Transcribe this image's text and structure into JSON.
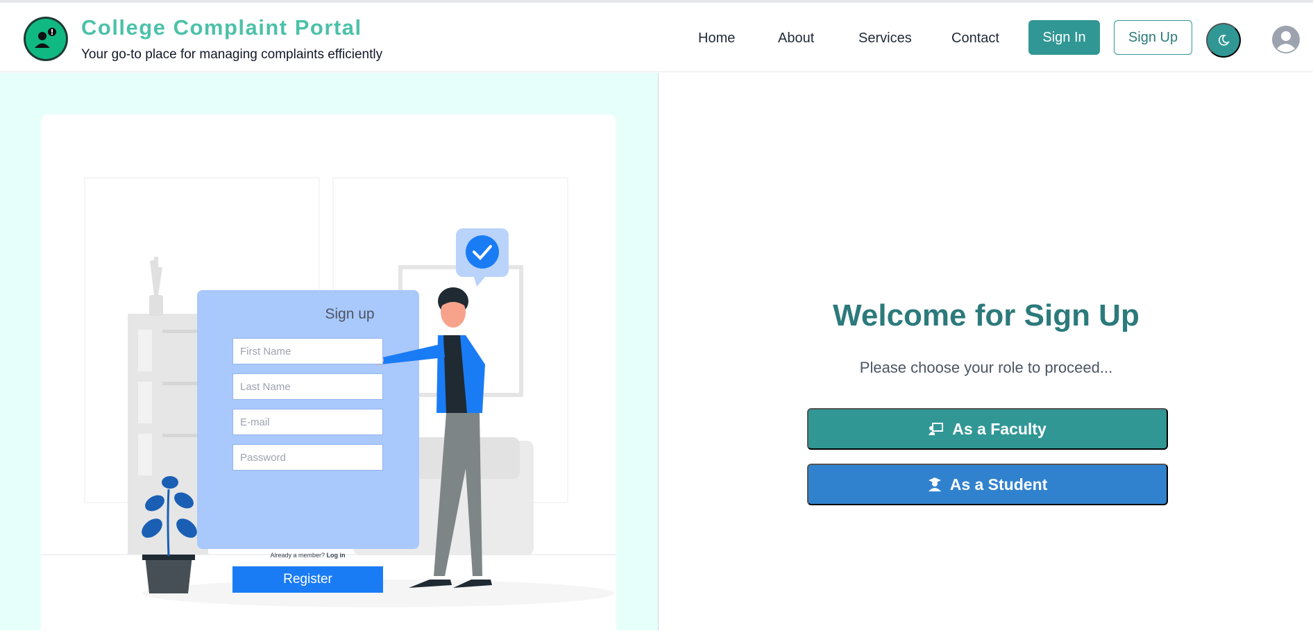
{
  "header": {
    "title": "College Complaint Portal",
    "subtitle": "Your go-to place for managing complaints efficiently",
    "nav": [
      "Home",
      "About",
      "Services",
      "Contact"
    ],
    "signin_label": "Sign In",
    "signup_label": "Sign Up"
  },
  "illustration": {
    "form_title": "Sign up",
    "fields": [
      "First Name",
      "Last Name",
      "E-mail",
      "Password"
    ],
    "already_text": "Already a member?",
    "login_text": "Log in",
    "register_label": "Register"
  },
  "main": {
    "heading": "Welcome for Sign Up",
    "subheading": "Please choose your role to proceed...",
    "faculty_label": "As a Faculty",
    "student_label": "As a Student"
  },
  "colors": {
    "brand": "#4cc1a9",
    "teal": "#319795",
    "blue": "#3182ce",
    "panel_bg": "#e6fffa"
  }
}
